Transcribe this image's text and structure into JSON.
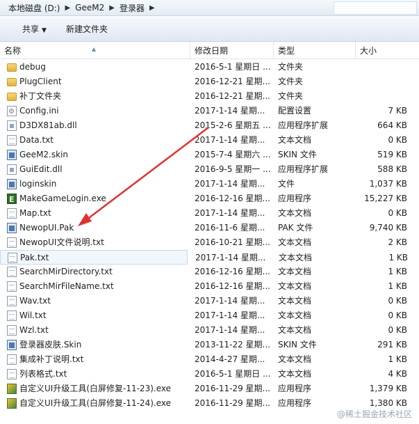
{
  "breadcrumb": [
    "本地磁盘 (D:)",
    "GeeM2",
    "登录器"
  ],
  "toolbar": {
    "share_label": "共享",
    "new_folder_label": "新建文件夹"
  },
  "columns": {
    "name": "名称",
    "date": "修改日期",
    "type": "类型",
    "size": "大小"
  },
  "files": [
    {
      "name": "debug",
      "date": "2016-5-1 星期日 ...",
      "type": "文件夹",
      "size": "",
      "icon": "folder-icon"
    },
    {
      "name": "PlugClient",
      "date": "2016-12-21 星期...",
      "type": "文件夹",
      "size": "",
      "icon": "folder-icon"
    },
    {
      "name": "补丁文件夹",
      "date": "2016-12-21 星期...",
      "type": "文件夹",
      "size": "",
      "icon": "folder-icon"
    },
    {
      "name": "Config.ini",
      "date": "2017-1-14 星期...",
      "type": "配置设置",
      "size": "7 KB",
      "icon": "settings-file-icon"
    },
    {
      "name": "D3DX81ab.dll",
      "date": "2015-2-6 星期五 ...",
      "type": "应用程序扩展",
      "size": "664 KB",
      "icon": "dll-file-icon"
    },
    {
      "name": "Data.txt",
      "date": "2017-1-14 星期...",
      "type": "文本文档",
      "size": "0 KB",
      "icon": "text-file-icon"
    },
    {
      "name": "GeeM2.skin",
      "date": "2015-7-4 星期六 ...",
      "type": "SKIN 文件",
      "size": "519 KB",
      "icon": "skin-file-icon"
    },
    {
      "name": "GuiEdit.dll",
      "date": "2016-9-5 星期一 ...",
      "type": "应用程序扩展",
      "size": "588 KB",
      "icon": "dll-file-icon"
    },
    {
      "name": "loginskin",
      "date": "2017-1-14 星期...",
      "type": "文件",
      "size": "1,037 KB",
      "icon": "generic-file-icon"
    },
    {
      "name": "MakeGameLogin.exe",
      "date": "2016-12-16 星期...",
      "type": "应用程序",
      "size": "15,227 KB",
      "icon": "exe-icon"
    },
    {
      "name": "Map.txt",
      "date": "2017-1-14 星期...",
      "type": "文本文档",
      "size": "0 KB",
      "icon": "text-file-icon"
    },
    {
      "name": "NewopUI.Pak",
      "date": "2016-11-6 星期...",
      "type": "PAK 文件",
      "size": "9,740 KB",
      "icon": "pak-file-icon"
    },
    {
      "name": "NewopUI文件说明.txt",
      "date": "2016-10-21 星期...",
      "type": "文本文档",
      "size": "2 KB",
      "icon": "text-file-icon"
    },
    {
      "name": "Pak.txt",
      "date": "2017-1-14 星期...",
      "type": "文本文档",
      "size": "1 KB",
      "icon": "text-file-icon",
      "selected": true
    },
    {
      "name": "SearchMirDirectory.txt",
      "date": "2016-12-16 星期...",
      "type": "文本文档",
      "size": "1 KB",
      "icon": "text-file-icon"
    },
    {
      "name": "SearchMirFileName.txt",
      "date": "2016-12-16 星期...",
      "type": "文本文档",
      "size": "1 KB",
      "icon": "text-file-icon"
    },
    {
      "name": "Wav.txt",
      "date": "2017-1-14 星期...",
      "type": "文本文档",
      "size": "0 KB",
      "icon": "text-file-icon"
    },
    {
      "name": "Wil.txt",
      "date": "2017-1-14 星期...",
      "type": "文本文档",
      "size": "0 KB",
      "icon": "text-file-icon"
    },
    {
      "name": "Wzl.txt",
      "date": "2017-1-14 星期...",
      "type": "文本文档",
      "size": "0 KB",
      "icon": "text-file-icon"
    },
    {
      "name": "登录器皮肤.Skin",
      "date": "2013-11-22 星期...",
      "type": "SKIN 文件",
      "size": "291 KB",
      "icon": "skin-file-icon"
    },
    {
      "name": "集成补丁说明.txt",
      "date": "2014-4-27 星期...",
      "type": "文本文档",
      "size": "1 KB",
      "icon": "text-file-icon"
    },
    {
      "name": "列表格式.txt",
      "date": "2016-5-1 星期日 ...",
      "type": "文本文档",
      "size": "4 KB",
      "icon": "text-file-icon"
    },
    {
      "name": "自定义UI升级工具(白屏修复-11-23).exe",
      "date": "2016-11-29 星期...",
      "type": "应用程序",
      "size": "1,379 KB",
      "icon": "tool-exe-icon"
    },
    {
      "name": "自定义UI升级工具(白屏修复-11-24).exe",
      "date": "2016-11-29 星期...",
      "type": "应用程序",
      "size": "1,380 KB",
      "icon": "tool-exe-icon"
    }
  ],
  "watermark": "@稀土掘金技术社区",
  "annotation": {
    "color": "#e03131"
  }
}
